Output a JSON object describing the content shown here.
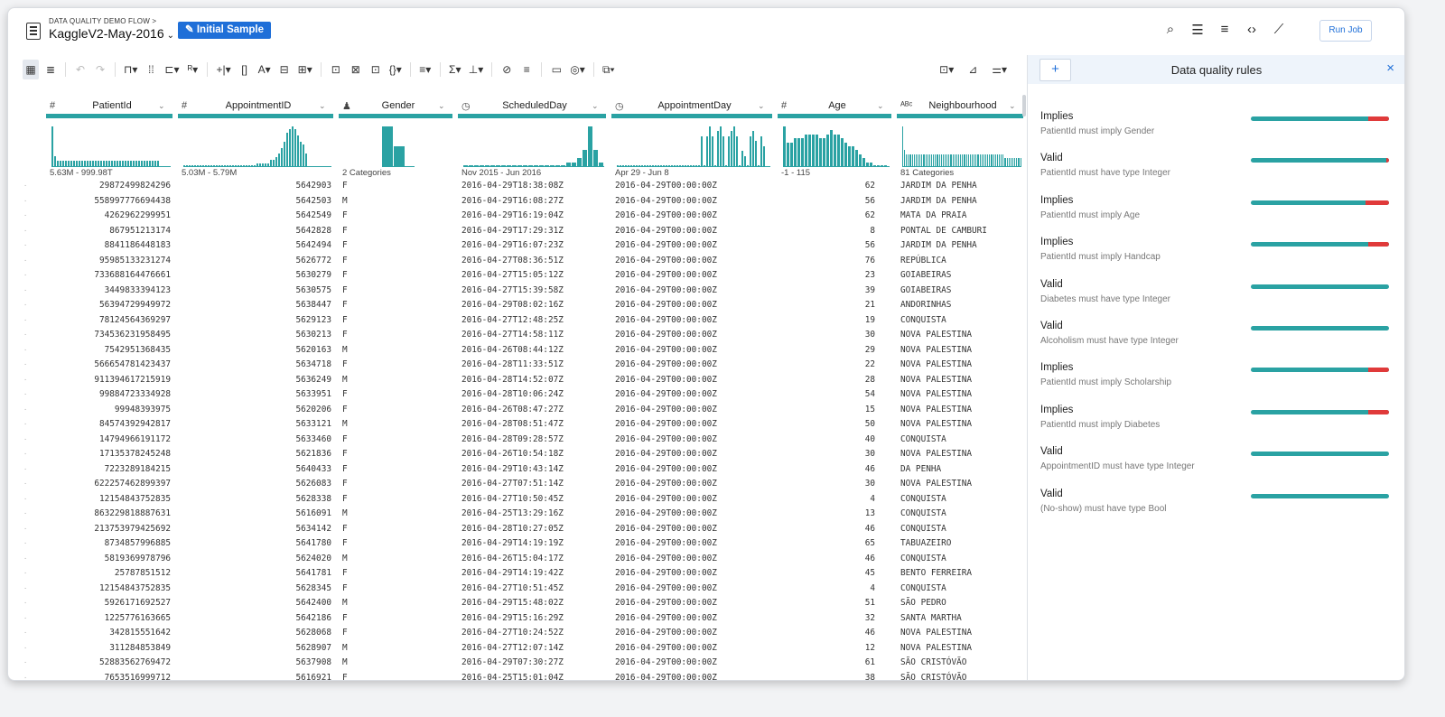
{
  "header": {
    "breadcrumb": "DATA QUALITY DEMO FLOW >",
    "dataset_name": "KaggleV2-May-2016",
    "sample_label": "Initial Sample",
    "run_job_label": "Run Job",
    "icons": [
      "search-icon",
      "list-icon",
      "checklist-icon",
      "code-icon",
      "wand-icon"
    ]
  },
  "toolbar": {
    "icons": [
      "grid-view-icon",
      "list-view-icon",
      "undo-icon",
      "redo-icon",
      "format-icon",
      "filter-values-icon",
      "merge-icon",
      "rename-icon",
      "split-icon",
      "expand-icon",
      "text-icon",
      "replace-icon",
      "extract-icon",
      "restructure-icon",
      "pivot-icon",
      "nest-icon",
      "json-icon",
      "filter-icon",
      "sum-icon",
      "hierarchy-icon",
      "join-icon",
      "sort-icon",
      "comment-icon",
      "macro-icon",
      "copy-icon"
    ],
    "right_icons": [
      "column-layout-icon",
      "details-icon",
      "settings-icon"
    ]
  },
  "columns": [
    {
      "name": "PatientId",
      "type_icon": "#",
      "range": "5.63M - 999.98T"
    },
    {
      "name": "AppointmentID",
      "type_icon": "#",
      "range": "5.03M - 5.79M"
    },
    {
      "name": "Gender",
      "type_icon": "person",
      "range": "2 Categories"
    },
    {
      "name": "ScheduledDay",
      "type_icon": "clock",
      "range": "Nov 2015 - Jun 2016"
    },
    {
      "name": "AppointmentDay",
      "type_icon": "clock",
      "range": "Apr 29 - Jun 8"
    },
    {
      "name": "Age",
      "type_icon": "#",
      "range": "-1 - 115"
    },
    {
      "name": "Neighbourhood",
      "type_icon": "ABC",
      "range": "81 Categories"
    }
  ],
  "histograms": {
    "PatientId": [
      8,
      2,
      1,
      1,
      1,
      1,
      1,
      1,
      1,
      1,
      1,
      1,
      1,
      1,
      1,
      1,
      1,
      1,
      1,
      1,
      1,
      1,
      1,
      1,
      1,
      1,
      1,
      1,
      1,
      1,
      1,
      1,
      1,
      1,
      1,
      1,
      1,
      1,
      1,
      1
    ],
    "AppointmentID": [
      0,
      0,
      0,
      0,
      0,
      0,
      0,
      0,
      0,
      0,
      0,
      0,
      0,
      0,
      0,
      0,
      0,
      0,
      0,
      0,
      0,
      0,
      0,
      0,
      0,
      0,
      0,
      1,
      1,
      1,
      1,
      1,
      2,
      2,
      3,
      4,
      6,
      8,
      11,
      12,
      13,
      12,
      10,
      8,
      7,
      4
    ],
    "Gender": [
      10,
      5
    ],
    "ScheduledDay": [
      0,
      0,
      0,
      0,
      0,
      0,
      0,
      0,
      0,
      0,
      0,
      0,
      0,
      0,
      0,
      0,
      0,
      0,
      0,
      1,
      1,
      2,
      4,
      10,
      4,
      1
    ],
    "AppointmentDay": [
      0,
      0,
      0,
      0,
      0,
      0,
      0,
      0,
      0,
      0,
      0,
      0,
      0,
      0,
      0,
      0,
      0,
      0,
      0,
      0,
      0,
      0,
      0,
      0,
      0,
      0,
      0,
      0,
      0,
      0,
      0,
      6,
      0,
      6,
      8,
      6,
      0,
      7,
      8,
      6,
      0,
      6,
      7,
      8,
      6,
      0,
      3,
      2,
      0,
      6,
      7,
      5,
      0,
      6,
      4
    ],
    "Age": [
      10,
      6,
      6,
      7,
      7,
      7,
      8,
      8,
      8,
      8,
      7,
      7,
      8,
      9,
      8,
      8,
      7,
      6,
      5,
      5,
      4,
      3,
      2,
      1,
      1,
      0,
      0,
      0,
      0
    ],
    "Neighbourhood": [
      10,
      4,
      3,
      3,
      3,
      3,
      3,
      3,
      3,
      3,
      3,
      3,
      3,
      3,
      3,
      3,
      3,
      3,
      3,
      3,
      3,
      3,
      3,
      3,
      3,
      3,
      3,
      3,
      3,
      3,
      3,
      3,
      3,
      3,
      3,
      3,
      3,
      3,
      3,
      3,
      3,
      3,
      3,
      3,
      3,
      3,
      3,
      3,
      3,
      3,
      3,
      3,
      3,
      3,
      3,
      3,
      3,
      3,
      3,
      3,
      2,
      2,
      2,
      2,
      2,
      2,
      2,
      2,
      2,
      2,
      2
    ]
  },
  "rows": [
    [
      "29872499824296",
      "5642903",
      "F",
      "2016-04-29T18:38:08Z",
      "2016-04-29T00:00:00Z",
      "62",
      "JARDIM DA PENHA"
    ],
    [
      "558997776694438",
      "5642503",
      "M",
      "2016-04-29T16:08:27Z",
      "2016-04-29T00:00:00Z",
      "56",
      "JARDIM DA PENHA"
    ],
    [
      "4262962299951",
      "5642549",
      "F",
      "2016-04-29T16:19:04Z",
      "2016-04-29T00:00:00Z",
      "62",
      "MATA DA PRAIA"
    ],
    [
      "867951213174",
      "5642828",
      "F",
      "2016-04-29T17:29:31Z",
      "2016-04-29T00:00:00Z",
      "8",
      "PONTAL DE CAMBURI"
    ],
    [
      "8841186448183",
      "5642494",
      "F",
      "2016-04-29T16:07:23Z",
      "2016-04-29T00:00:00Z",
      "56",
      "JARDIM DA PENHA"
    ],
    [
      "95985133231274",
      "5626772",
      "F",
      "2016-04-27T08:36:51Z",
      "2016-04-29T00:00:00Z",
      "76",
      "REPÚBLICA"
    ],
    [
      "733688164476661",
      "5630279",
      "F",
      "2016-04-27T15:05:12Z",
      "2016-04-29T00:00:00Z",
      "23",
      "GOIABEIRAS"
    ],
    [
      "3449833394123",
      "5630575",
      "F",
      "2016-04-27T15:39:58Z",
      "2016-04-29T00:00:00Z",
      "39",
      "GOIABEIRAS"
    ],
    [
      "56394729949972",
      "5638447",
      "F",
      "2016-04-29T08:02:16Z",
      "2016-04-29T00:00:00Z",
      "21",
      "ANDORINHAS"
    ],
    [
      "78124564369297",
      "5629123",
      "F",
      "2016-04-27T12:48:25Z",
      "2016-04-29T00:00:00Z",
      "19",
      "CONQUISTA"
    ],
    [
      "734536231958495",
      "5630213",
      "F",
      "2016-04-27T14:58:11Z",
      "2016-04-29T00:00:00Z",
      "30",
      "NOVA PALESTINA"
    ],
    [
      "7542951368435",
      "5620163",
      "M",
      "2016-04-26T08:44:12Z",
      "2016-04-29T00:00:00Z",
      "29",
      "NOVA PALESTINA"
    ],
    [
      "566654781423437",
      "5634718",
      "F",
      "2016-04-28T11:33:51Z",
      "2016-04-29T00:00:00Z",
      "22",
      "NOVA PALESTINA"
    ],
    [
      "911394617215919",
      "5636249",
      "M",
      "2016-04-28T14:52:07Z",
      "2016-04-29T00:00:00Z",
      "28",
      "NOVA PALESTINA"
    ],
    [
      "99884723334928",
      "5633951",
      "F",
      "2016-04-28T10:06:24Z",
      "2016-04-29T00:00:00Z",
      "54",
      "NOVA PALESTINA"
    ],
    [
      "99948393975",
      "5620206",
      "F",
      "2016-04-26T08:47:27Z",
      "2016-04-29T00:00:00Z",
      "15",
      "NOVA PALESTINA"
    ],
    [
      "84574392942817",
      "5633121",
      "M",
      "2016-04-28T08:51:47Z",
      "2016-04-29T00:00:00Z",
      "50",
      "NOVA PALESTINA"
    ],
    [
      "14794966191172",
      "5633460",
      "F",
      "2016-04-28T09:28:57Z",
      "2016-04-29T00:00:00Z",
      "40",
      "CONQUISTA"
    ],
    [
      "17135378245248",
      "5621836",
      "F",
      "2016-04-26T10:54:18Z",
      "2016-04-29T00:00:00Z",
      "30",
      "NOVA PALESTINA"
    ],
    [
      "7223289184215",
      "5640433",
      "F",
      "2016-04-29T10:43:14Z",
      "2016-04-29T00:00:00Z",
      "46",
      "DA PENHA"
    ],
    [
      "622257462899397",
      "5626083",
      "F",
      "2016-04-27T07:51:14Z",
      "2016-04-29T00:00:00Z",
      "30",
      "NOVA PALESTINA"
    ],
    [
      "12154843752835",
      "5628338",
      "F",
      "2016-04-27T10:50:45Z",
      "2016-04-29T00:00:00Z",
      "4",
      "CONQUISTA"
    ],
    [
      "863229818887631",
      "5616091",
      "M",
      "2016-04-25T13:29:16Z",
      "2016-04-29T00:00:00Z",
      "13",
      "CONQUISTA"
    ],
    [
      "213753979425692",
      "5634142",
      "F",
      "2016-04-28T10:27:05Z",
      "2016-04-29T00:00:00Z",
      "46",
      "CONQUISTA"
    ],
    [
      "8734857996885",
      "5641780",
      "F",
      "2016-04-29T14:19:19Z",
      "2016-04-29T00:00:00Z",
      "65",
      "TABUAZEIRO"
    ],
    [
      "5819369978796",
      "5624020",
      "M",
      "2016-04-26T15:04:17Z",
      "2016-04-29T00:00:00Z",
      "46",
      "CONQUISTA"
    ],
    [
      "25787851512",
      "5641781",
      "F",
      "2016-04-29T14:19:42Z",
      "2016-04-29T00:00:00Z",
      "45",
      "BENTO FERREIRA"
    ],
    [
      "12154843752835",
      "5628345",
      "F",
      "2016-04-27T10:51:45Z",
      "2016-04-29T00:00:00Z",
      "4",
      "CONQUISTA"
    ],
    [
      "5926171692527",
      "5642400",
      "M",
      "2016-04-29T15:48:02Z",
      "2016-04-29T00:00:00Z",
      "51",
      "SÃO PEDRO"
    ],
    [
      "1225776163665",
      "5642186",
      "F",
      "2016-04-29T15:16:29Z",
      "2016-04-29T00:00:00Z",
      "32",
      "SANTA MARTHA"
    ],
    [
      "342815551642",
      "5628068",
      "F",
      "2016-04-27T10:24:52Z",
      "2016-04-29T00:00:00Z",
      "46",
      "NOVA PALESTINA"
    ],
    [
      "311284853849",
      "5628907",
      "M",
      "2016-04-27T12:07:14Z",
      "2016-04-29T00:00:00Z",
      "12",
      "NOVA PALESTINA"
    ],
    [
      "52883562769472",
      "5637908",
      "M",
      "2016-04-29T07:30:27Z",
      "2016-04-29T00:00:00Z",
      "61",
      "SÃO CRISTÓVÃO"
    ],
    [
      "7653516999712",
      "5616921",
      "F",
      "2016-04-25T15:01:04Z",
      "2016-04-29T00:00:00Z",
      "38",
      "SÃO CRISTÓVÃO"
    ]
  ],
  "panel": {
    "title": "Data quality rules",
    "add_label": "+",
    "close_label": "×",
    "rules": [
      {
        "type": "Implies",
        "desc": "PatientId must imply Gender",
        "pass": 0.85
      },
      {
        "type": "Valid",
        "desc": "PatientId must have type Integer",
        "pass": 0.98
      },
      {
        "type": "Implies",
        "desc": "PatientId must imply Age",
        "pass": 0.83
      },
      {
        "type": "Implies",
        "desc": "PatientId must imply Handcap",
        "pass": 0.85
      },
      {
        "type": "Valid",
        "desc": "Diabetes must have type Integer",
        "pass": 1.0
      },
      {
        "type": "Valid",
        "desc": "Alcoholism must have type Integer",
        "pass": 1.0
      },
      {
        "type": "Implies",
        "desc": "PatientId must imply Scholarship",
        "pass": 0.85
      },
      {
        "type": "Implies",
        "desc": "PatientId must imply Diabetes",
        "pass": 0.85
      },
      {
        "type": "Valid",
        "desc": "AppointmentID must have type Integer",
        "pass": 1.0
      },
      {
        "type": "Valid",
        "desc": "(No-show) must have type Bool",
        "pass": 1.0
      }
    ]
  },
  "colors": {
    "accent": "#1f6fd8",
    "teal": "#2aa2a3",
    "error": "#e03a3a"
  }
}
